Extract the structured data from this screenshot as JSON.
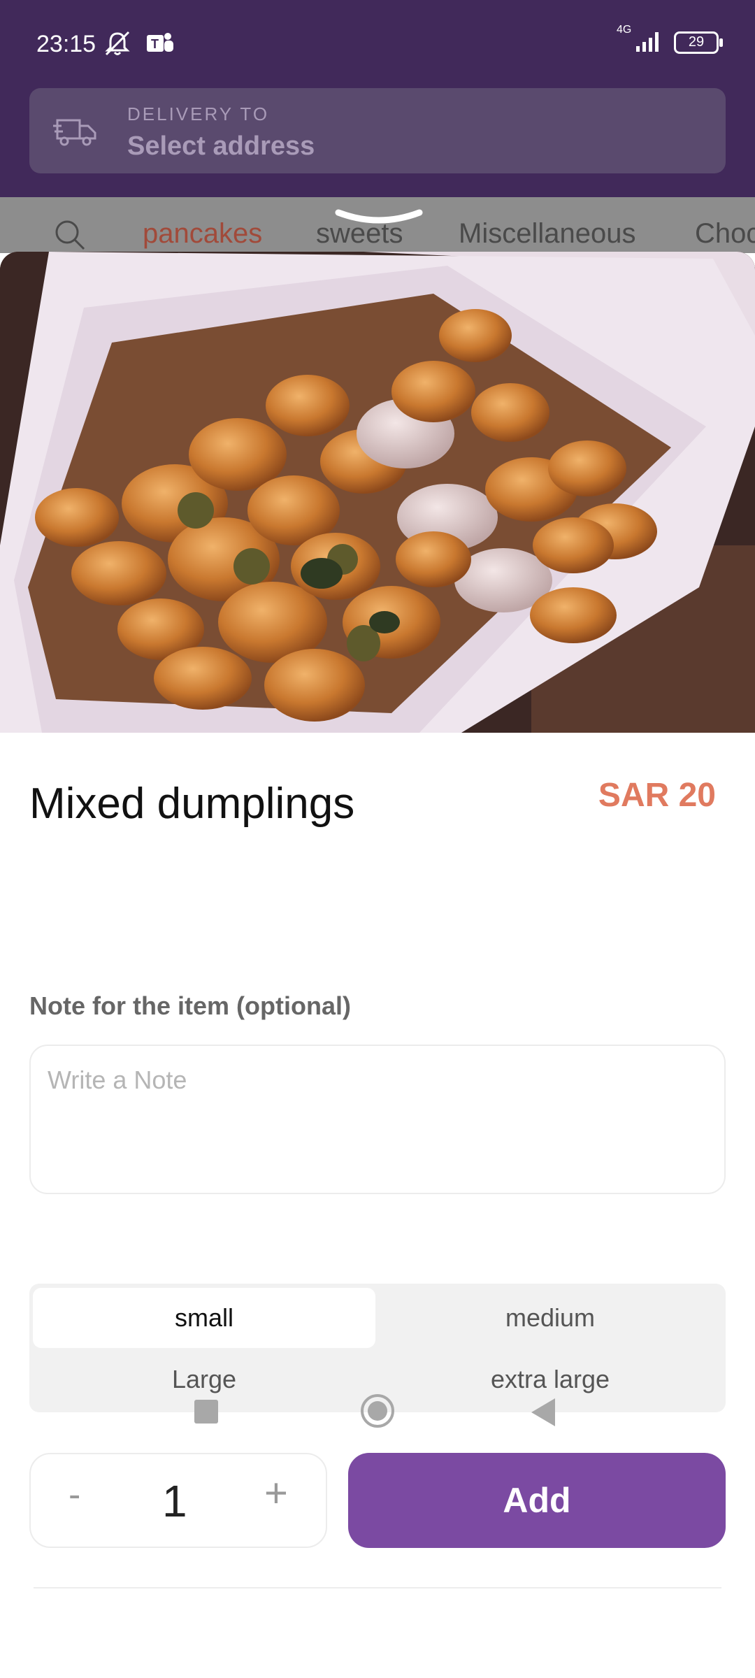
{
  "status_bar": {
    "time": "23:15",
    "network": "4G",
    "battery": "29",
    "icons": [
      "mute-icon",
      "teams-icon",
      "signal-icon",
      "battery-icon"
    ]
  },
  "header": {
    "delivery_caption": "DELIVERY TO",
    "delivery_address": "Select address"
  },
  "tabs": [
    {
      "label": "pancakes",
      "active": true
    },
    {
      "label": "sweets",
      "active": false
    },
    {
      "label": "Miscellaneous",
      "active": false
    },
    {
      "label": "Choc",
      "active": false
    }
  ],
  "item": {
    "title": "Mixed dumplings",
    "price": "SAR 20"
  },
  "note": {
    "label": "Note for the item (optional)",
    "placeholder": "Write a Note",
    "value": ""
  },
  "sizes": {
    "options": [
      "small",
      "medium",
      "Large",
      "extra large"
    ],
    "selected": "small"
  },
  "quantity": {
    "minus": "-",
    "value": "1",
    "plus": "+"
  },
  "actions": {
    "add_label": "Add"
  },
  "colors": {
    "header_bg": "#41295a",
    "accent_price": "#e07a5f",
    "add_button": "#7b4aa2"
  }
}
